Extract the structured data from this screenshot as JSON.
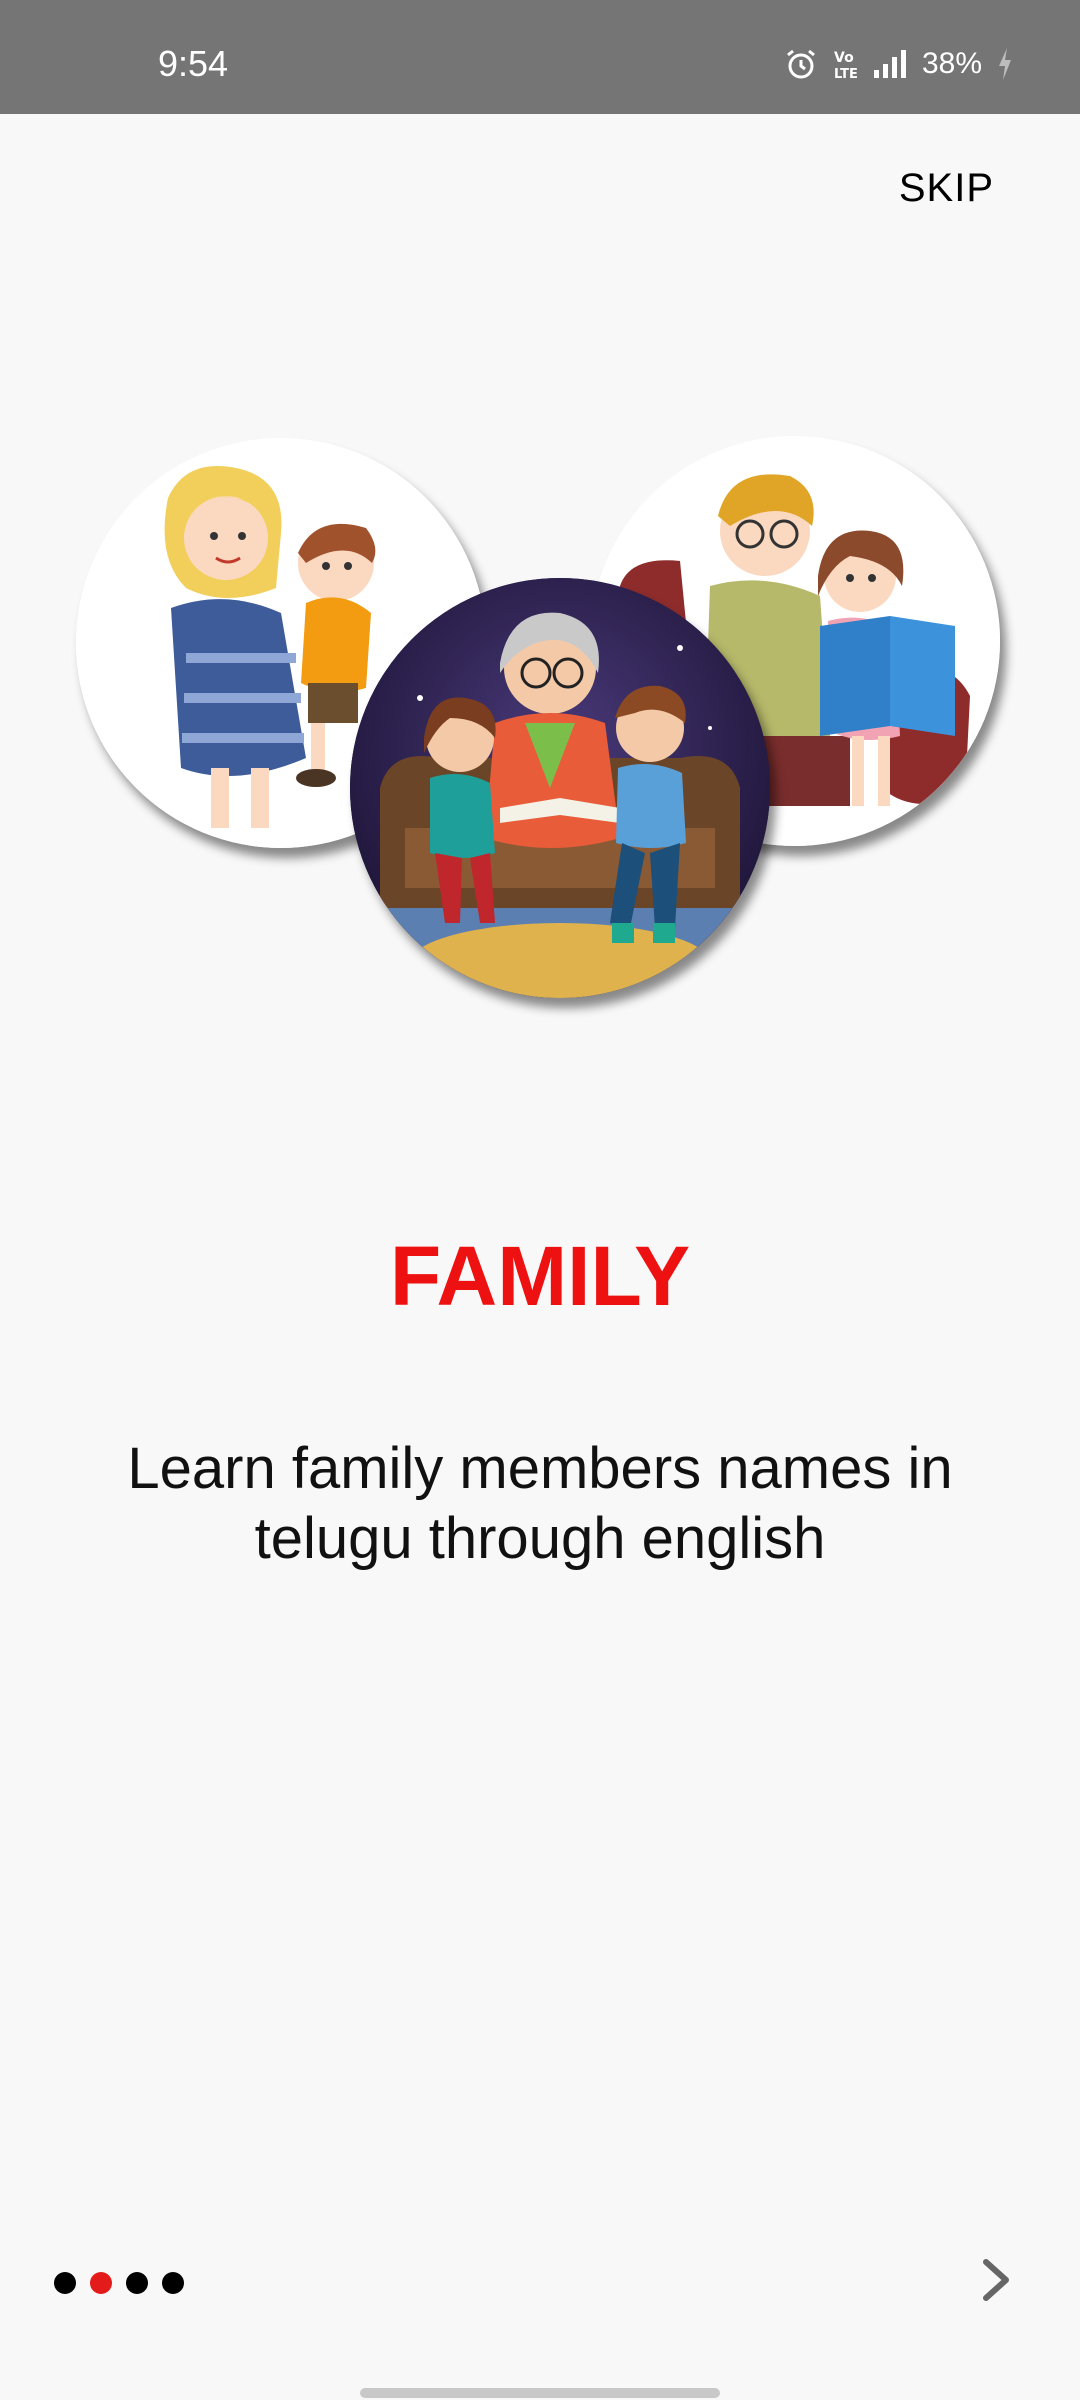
{
  "status_bar": {
    "time": "9:54",
    "battery": "38%",
    "icons": [
      "alarm-icon",
      "volte-icon",
      "signal-icon",
      "charging-icon"
    ]
  },
  "header": {
    "skip_label": "SKIP"
  },
  "hero": {
    "images": [
      "mother-with-child",
      "grandmother-reading-to-kids",
      "father-reading-with-daughter"
    ]
  },
  "content": {
    "title": "FAMILY",
    "description": "Learn family members names in telugu through english"
  },
  "pager": {
    "total": 4,
    "active_index": 1
  },
  "colors": {
    "accent": "#ee1111",
    "status_bar": "#757575",
    "background": "#f8f8f8"
  }
}
